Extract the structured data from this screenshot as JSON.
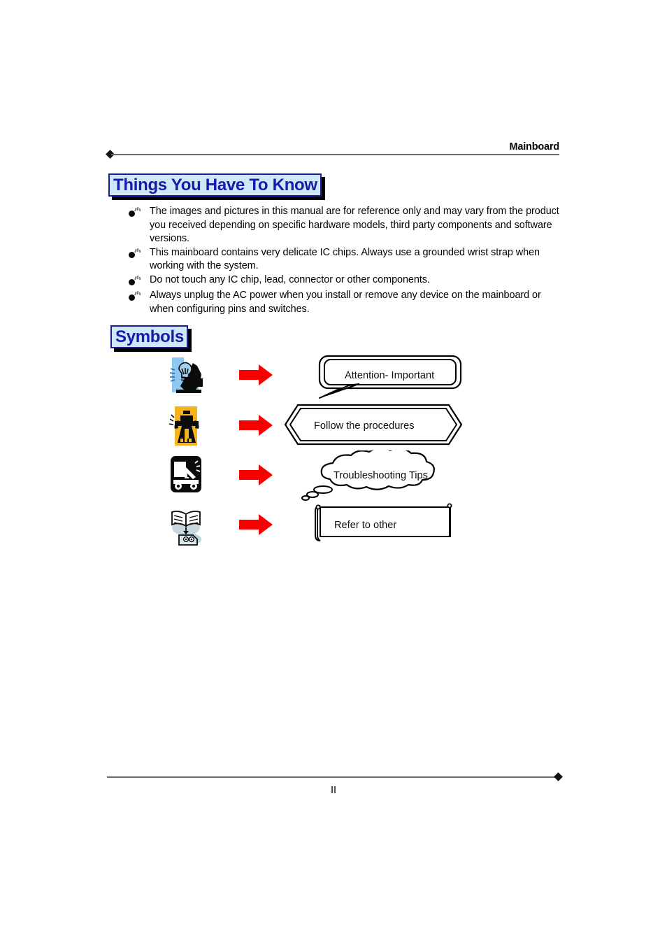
{
  "header": {
    "title": "Mainboard",
    "marker_icon": "diamond-icon"
  },
  "sections": {
    "things_to_know": {
      "heading": "Things You Have To Know",
      "heading_text_color": "#1a1aa8",
      "heading_fill_color": "#cfe8f8",
      "heading_border_color": "#1b1b8f",
      "bullet_icon": "bomb-bullet-icon",
      "bullets": [
        "The images and pictures in this manual are for reference only and may vary from the product you received depending on specific hardware models, third party components and software versions.",
        "This mainboard contains very delicate IC chips. Always use a grounded wrist strap when working with the system.",
        "Do not touch any IC chip, lead, connector or other components.",
        "Always unplug the AC power when you install or remove any device on the mainboard or when configuring pins and switches."
      ]
    },
    "symbols": {
      "heading": "Symbols",
      "arrow_icon": "red-right-arrow-icon",
      "arrow_color": "#f90000",
      "rows": [
        {
          "icon": "lightbulb-person-icon",
          "icon_background_color": "#8fc8ef",
          "callout_shape": "speech-bubble-lightning-callout",
          "label": "Attention- Important"
        },
        {
          "icon": "warning-figure-icon",
          "icon_background_color": "#f5b41c",
          "callout_shape": "hexagon-callout",
          "label": "Follow the procedures"
        },
        {
          "icon": "tow-truck-icon",
          "icon_background_color": "#000000",
          "callout_shape": "cloud-callout",
          "label": "Troubleshooting Tips"
        },
        {
          "icon": "open-book-icon",
          "icon_background_color": "#c6d8dd",
          "callout_shape": "scroll-banner-callout",
          "label": "Refer to other"
        }
      ]
    }
  },
  "footer": {
    "page_number": "II",
    "marker_icon": "diamond-icon"
  }
}
